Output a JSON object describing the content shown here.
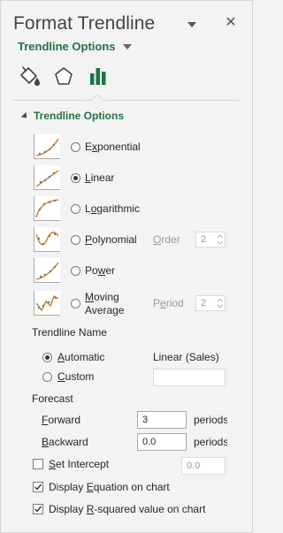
{
  "header": {
    "title": "Format Trendline",
    "close_glyph": "✕",
    "subtitle": "Trendline Options"
  },
  "tabs": [
    {
      "name": "fill-line-tab",
      "icon": "paint-bucket-icon"
    },
    {
      "name": "effects-tab",
      "icon": "pentagon-icon"
    },
    {
      "name": "trendline-options-tab",
      "icon": "bar-chart-icon",
      "selected": true
    }
  ],
  "section": {
    "title": "Trendline Options"
  },
  "types": [
    {
      "pre": "E",
      "u": "x",
      "post": "ponential",
      "selected": false
    },
    {
      "pre": "",
      "u": "L",
      "post": "inear",
      "selected": true
    },
    {
      "pre": "L",
      "u": "o",
      "post": "garithmic",
      "selected": false
    },
    {
      "pre": "",
      "u": "P",
      "post": "olynomial",
      "selected": false
    },
    {
      "pre": "Po",
      "u": "w",
      "post": "er",
      "selected": false
    },
    {
      "pre": "",
      "u": "M",
      "post": "oving",
      "line2": "Average",
      "selected": false
    }
  ],
  "order": {
    "label_pre": "",
    "label_u": "O",
    "label_post": "rder",
    "value": "2"
  },
  "period": {
    "label_pre": "P",
    "label_u": "e",
    "label_post": "riod",
    "value": "2"
  },
  "trendline_name": {
    "heading": "Trendline Name",
    "automatic": {
      "pre": "",
      "u": "A",
      "post": "utomatic",
      "selected": true
    },
    "automatic_value": "Linear (Sales)",
    "custom": {
      "pre": "",
      "u": "C",
      "post": "ustom",
      "selected": false
    },
    "custom_value": ""
  },
  "forecast": {
    "heading": "Forecast",
    "forward": {
      "pre": "",
      "u": "F",
      "post": "orward",
      "value": "3",
      "unit": "periods"
    },
    "backward": {
      "pre": "",
      "u": "B",
      "post": "ackward",
      "value": "0.0",
      "unit": "periods"
    }
  },
  "options": [
    {
      "pre": "",
      "u": "S",
      "post": "et Intercept",
      "checked": false,
      "value": "0.0"
    },
    {
      "pre": "Display ",
      "u": "E",
      "post": "quation on chart",
      "checked": true
    },
    {
      "pre": "Display ",
      "u": "R",
      "post": "-squared value on chart",
      "checked": true
    }
  ],
  "colors": {
    "accent": "#217346",
    "background": "#f3f3f3",
    "trend_line": "#e46c0a"
  }
}
